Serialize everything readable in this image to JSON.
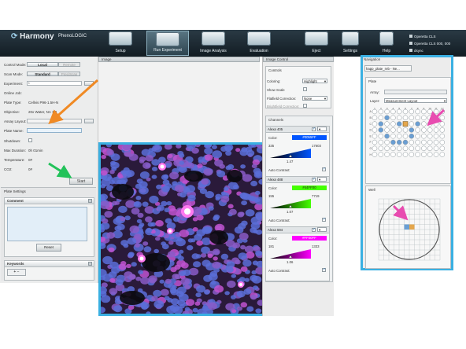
{
  "app": {
    "brand": "Harmony",
    "brand_sub": "PhenoLOGIC",
    "toolbar": [
      {
        "label": "Setup",
        "active": false
      },
      {
        "label": "Run Experiment",
        "active": true
      },
      {
        "label": "Image Analysis",
        "active": false
      },
      {
        "label": "Evaluation",
        "active": false
      },
      {
        "label": "Eject",
        "active": false
      },
      {
        "label": "Help",
        "active": false
      },
      {
        "label": "Settings",
        "active": false
      }
    ],
    "servers": [
      "Operetta CLS",
      "Operetta CLS 000, 000",
      "dsync"
    ]
  },
  "left": {
    "control_mode": {
      "label": "Control Mode:",
      "opt_on": "Local",
      "opt_off": "Remote"
    },
    "scan_mode": {
      "label": "Scan Mode:",
      "opt_on": "Standard",
      "opt_off": "PreciScan"
    },
    "experiment": {
      "label": "Experiment:",
      "value": "*"
    },
    "online_job": {
      "label": "Online Job:"
    },
    "plate_type": {
      "label": "Plate Type:",
      "value": "Cellvis P96-1.5H-N"
    },
    "objective": {
      "label": "Objective:",
      "value": "20x Water, NA 1.0"
    },
    "assay_layout": {
      "label": "Assay Layout:"
    },
    "plate_name": {
      "label": "Plate Name:"
    },
    "shutdown": {
      "label": "Shutdown:"
    },
    "max_duration": {
      "label": "Max Duration:",
      "value": "0h 01min"
    },
    "temperature": {
      "label": "Temperature:",
      "value": "0#"
    },
    "co2": {
      "label": "CO2:",
      "value": "0#"
    },
    "start_label": "Start",
    "plate_settings": {
      "title": "Plate Settings",
      "comment_title": "Comment",
      "reset_label": "Reset",
      "keywords_title": "Keywords"
    }
  },
  "image_panel": {
    "title": "Image"
  },
  "controls": {
    "panel_title": "Image Control",
    "section_title": "Controls",
    "coloring": {
      "label": "Coloring:",
      "value": "Highlight"
    },
    "show_scale": {
      "label": "Show Scale"
    },
    "flatfield": {
      "label": "Flatfield Correction:",
      "value": "None"
    },
    "brightfield": {
      "label": "Brightfield Correction:"
    },
    "channels_title": "Channels",
    "color_label": "Color:",
    "auto_contrast_label": "Auto Contrast:",
    "channels": [
      {
        "name": "Alexa 405",
        "color_hex": "#0055FF",
        "color_text": "#0055FF",
        "min": "335",
        "max": "17603",
        "gamma": "1.47"
      },
      {
        "name": "Alexa 488",
        "color_hex": "#44FF00",
        "color_text": "#44FF00",
        "min": "155",
        "max": "7719",
        "gamma": "1.07"
      },
      {
        "name": "Alexa 594",
        "color_hex": "#FF00FF",
        "color_text": "#FF00FF",
        "min": "181",
        "max": "1333",
        "gamma": "1.06"
      }
    ]
  },
  "navigation": {
    "title": "Navigation",
    "tab": "happ_plate_reb - Ne...",
    "plate_title": "Plate",
    "array_label": "Array:",
    "layer_label": "Layer:",
    "layer_value": "Measurement Layout",
    "columns": [
      "1",
      "2",
      "3",
      "4",
      "5",
      "6",
      "7",
      "8",
      "9",
      "10",
      "11",
      "12"
    ],
    "rows": [
      "A",
      "B",
      "C",
      "D",
      "E",
      "F",
      "G",
      "H"
    ],
    "well_title": "Well"
  },
  "colors": {
    "highlight": "#3ab0e2",
    "arrow_orange": "#f08a24",
    "arrow_green": "#22c25a",
    "arrow_pink": "#e84cb0"
  }
}
